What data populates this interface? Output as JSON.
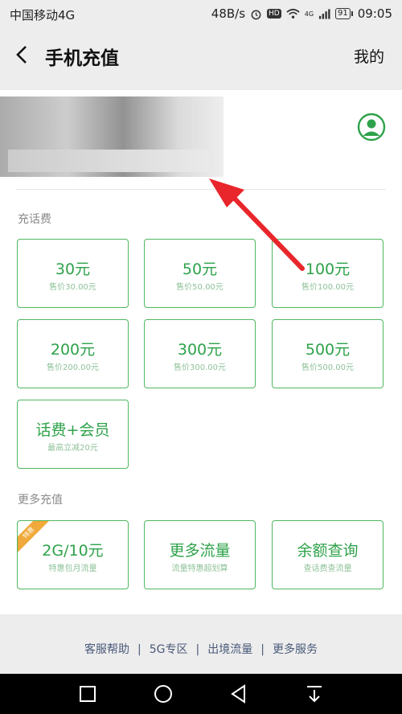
{
  "status": {
    "carrier": "中国移动4G",
    "speed": "48B/s",
    "hd": "HD",
    "network": "4G",
    "battery": "91",
    "time": "09:05"
  },
  "nav": {
    "title": "手机充值",
    "mine": "我的"
  },
  "sections": {
    "recharge_label": "充话费",
    "more_label": "更多充值"
  },
  "recharge_options": [
    {
      "main": "30元",
      "sub": "售价30.00元"
    },
    {
      "main": "50元",
      "sub": "售价50.00元"
    },
    {
      "main": "100元",
      "sub": "售价100.00元"
    },
    {
      "main": "200元",
      "sub": "售价200.00元"
    },
    {
      "main": "300元",
      "sub": "售价300.00元"
    },
    {
      "main": "500元",
      "sub": "售价500.00元"
    },
    {
      "main": "话费+会员",
      "sub": "最高立减20元"
    }
  ],
  "more_options": [
    {
      "main": "2G/10元",
      "sub": "特惠包月流量",
      "badge": "特惠"
    },
    {
      "main": "更多流量",
      "sub": "流量特惠超划算"
    },
    {
      "main": "余额查询",
      "sub": "查话费查流量"
    }
  ],
  "footer": {
    "links": [
      "客服帮助",
      "5G专区",
      "出境流量",
      "更多服务"
    ]
  },
  "colors": {
    "accent": "#2ea24a",
    "border": "#4fb85f",
    "arrow": "#e8262b",
    "badge": "#f0a93a"
  },
  "icons": [
    "back-icon",
    "avatar-icon",
    "alarm-icon",
    "wifi-icon",
    "signal-icon",
    "square-nav-icon",
    "circle-nav-icon",
    "triangle-back-nav-icon",
    "download-nav-icon"
  ]
}
